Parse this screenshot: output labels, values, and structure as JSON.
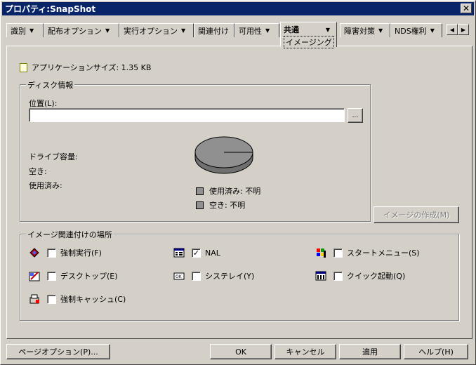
{
  "window": {
    "title": "プロパティ:SnapShot"
  },
  "tabs": [
    {
      "label": "識別",
      "has_dropdown": true
    },
    {
      "label": "配布オプション",
      "has_dropdown": true
    },
    {
      "label": "実行オプション",
      "has_dropdown": true
    },
    {
      "label": "関連付け",
      "has_dropdown": false
    },
    {
      "label": "可用性",
      "has_dropdown": true
    },
    {
      "label": "共通",
      "sub_label": "イメージング",
      "has_dropdown": true,
      "active": true
    },
    {
      "label": "障害対策",
      "has_dropdown": true
    },
    {
      "label": "NDS権利",
      "has_dropdown": true
    }
  ],
  "app_size": {
    "text": "アプリケーションサイズ: 1.35 KB"
  },
  "disk_info": {
    "legend": "ディスク情報",
    "location_label": "位置(L):",
    "location_value": "",
    "browse_label": "…",
    "drive_capacity_label": "ドライブ容量:",
    "free_label": "空き:",
    "used_label": "使用済み:",
    "pie_legend_used": "使用済み: 不明",
    "pie_legend_free": "空き: 不明",
    "pie_color": "#909090"
  },
  "create_image_button": "イメージの作成(M)",
  "association": {
    "legend": "イメージ関連付けの場所",
    "items": [
      {
        "label": "強制実行(F)",
        "checked": false,
        "icon": "force-run-icon"
      },
      {
        "label": "NAL",
        "checked": true,
        "icon": "nal-icon"
      },
      {
        "label": "スタートメニュー(S)",
        "checked": false,
        "icon": "start-menu-icon"
      },
      {
        "label": "デスクトップ(E)",
        "checked": false,
        "icon": "desktop-icon"
      },
      {
        "label": "システレイ(Y)",
        "checked": false,
        "icon": "system-tray-icon"
      },
      {
        "label": "クイック起動(Q)",
        "checked": false,
        "icon": "quick-launch-icon"
      },
      {
        "label": "強制キャッシュ(C)",
        "checked": false,
        "icon": "force-cache-icon"
      }
    ]
  },
  "footer": {
    "page_options": "ページオプション(P)...",
    "ok": "OK",
    "cancel": "キャンセル",
    "apply": "適用",
    "help": "ヘルプ(H)"
  },
  "checkmark": "✓",
  "colors": {
    "titlebar": "#0a246a",
    "face": "#d4d0c8"
  }
}
